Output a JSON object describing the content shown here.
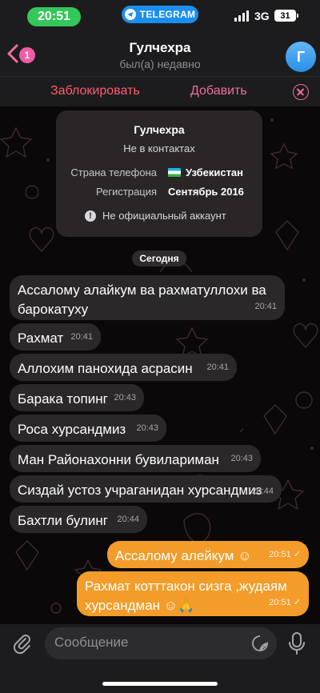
{
  "status_bar": {
    "time": "20:51",
    "app_pill": "TELEGRAM",
    "network": "3G",
    "battery": "31"
  },
  "header": {
    "back_badge": "1",
    "title": "Гулчехра",
    "subtitle": "был(а) недавно",
    "avatar_letter": "Г"
  },
  "action_bar": {
    "block_label": "Заблокировать",
    "add_label": "Добавить"
  },
  "info_card": {
    "name": "Гулчехра",
    "contact_state": "Не в контактах",
    "rows": [
      {
        "label": "Страна телефона",
        "value": "Узбекистан"
      },
      {
        "label": "Регистрация",
        "value": "Сентябрь 2016"
      }
    ],
    "note": "Не официальный аккаунт"
  },
  "date_separator": "Сегодня",
  "messages": [
    {
      "dir": "in",
      "text": "Ассалому алайкум ва рахматуллохи ва барокатуху",
      "time": "20:41"
    },
    {
      "dir": "in",
      "text": "Рахмат",
      "time": "20:41"
    },
    {
      "dir": "in",
      "text": "Аллохим панохида асрасин",
      "time": "20:41"
    },
    {
      "dir": "in",
      "text": "Барака топинг",
      "time": "20:43"
    },
    {
      "dir": "in",
      "text": "Роса хурсандмиз",
      "time": "20:43"
    },
    {
      "dir": "in",
      "text": "Ман Районахонни бувилариман",
      "time": "20:43"
    },
    {
      "dir": "in",
      "text": "Сиздай устоз учраганидан хурсандмиз",
      "time": "20:44"
    },
    {
      "dir": "in",
      "text": "Бахтли булинг",
      "time": "20:44"
    },
    {
      "dir": "out",
      "text": "Ассалому алейкум ☺",
      "time": "20:51"
    },
    {
      "dir": "out",
      "text": "Рахмат котттакон сизга ,жудаям хурсандман ☺🙏",
      "time": "20:51"
    }
  ],
  "composer": {
    "placeholder": "Сообщение"
  },
  "colors": {
    "outgoing_bubble": "#f39c2a",
    "incoming_bubble": "#2b282a",
    "accent_pink": "#ef6f9c",
    "block_red": "#ff5b6e",
    "time_pill": "#34c759",
    "telegram_pill": "#1a8ff0"
  }
}
